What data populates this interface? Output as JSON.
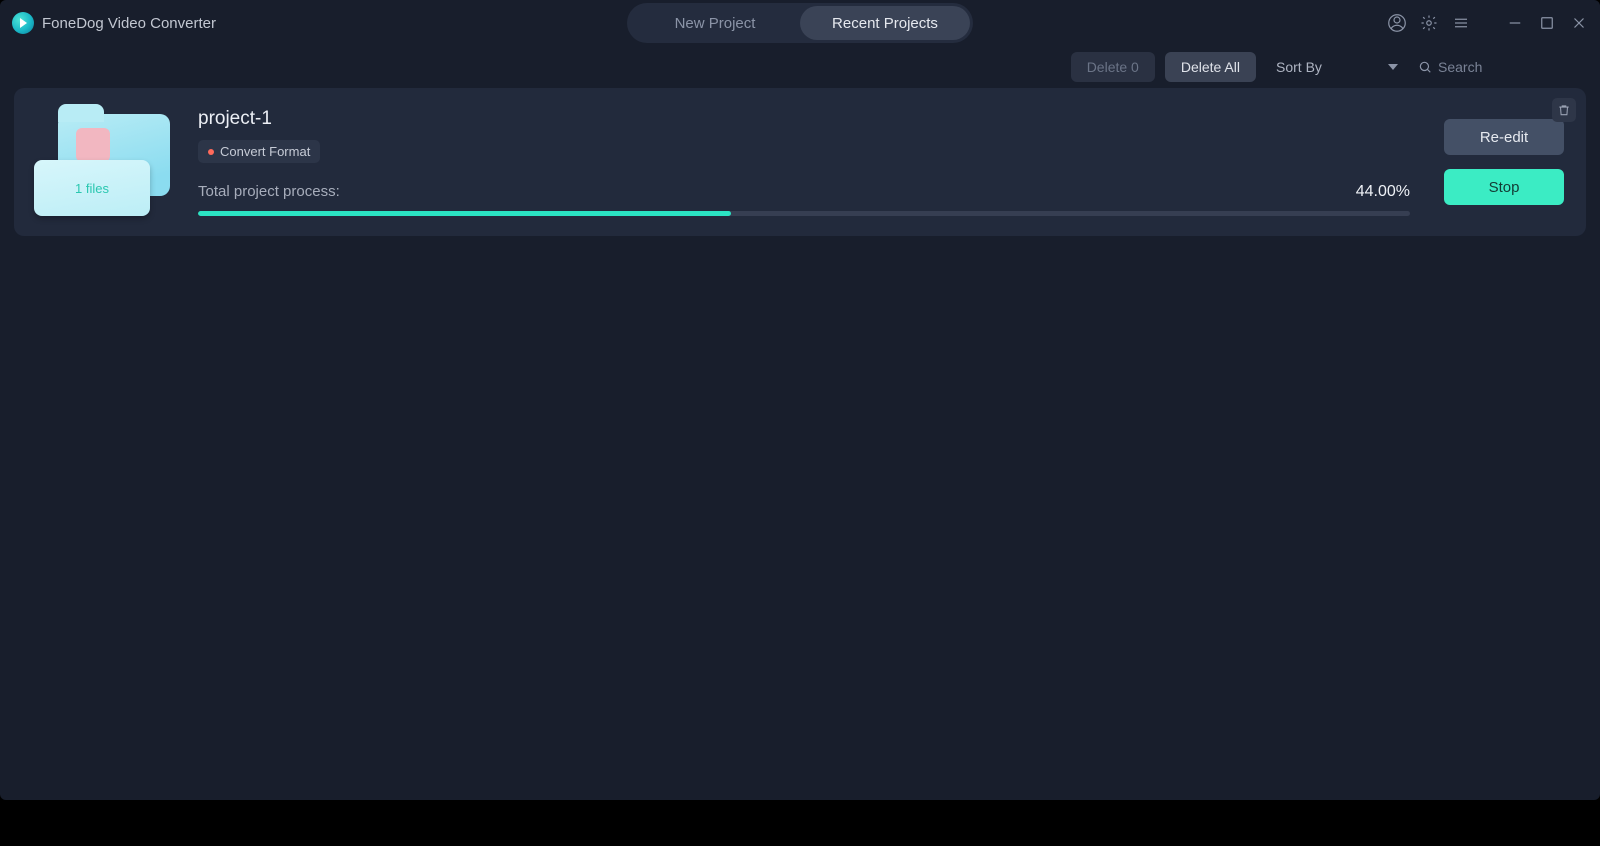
{
  "brand": {
    "title": "FoneDog Video Converter"
  },
  "tabs": {
    "new_project": "New Project",
    "recent_projects": "Recent Projects",
    "active": "recent"
  },
  "toolbar": {
    "delete_count_label": "Delete 0",
    "delete_all_label": "Delete All",
    "sort_by_label": "Sort By",
    "search_placeholder": "Search"
  },
  "project": {
    "name": "project-1",
    "chip_label": "Convert Format",
    "files_label": "1 files",
    "process_label": "Total project process:",
    "process_pct_text": "44.00%",
    "process_pct_value": 44,
    "reedit_label": "Re-edit",
    "stop_label": "Stop"
  },
  "icons": {
    "account": "account-icon",
    "settings": "gear-icon",
    "menu": "hamburger-icon",
    "minimize": "minimize-icon",
    "maximize": "maximize-icon",
    "close": "close-icon",
    "search": "search-icon",
    "trash": "trash-icon",
    "chevron": "chevron-down-icon"
  }
}
